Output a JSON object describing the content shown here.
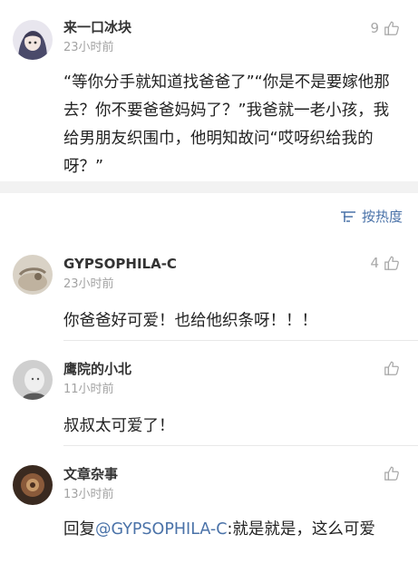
{
  "comments": [
    {
      "user": "来一口冰块",
      "time": "23小时前",
      "likes": "9",
      "text": "“等你分手就知道找爸爸了”“你是不是要嫁他那去？你不要爸爸妈妈了？”我爸就一老小孩，我给男朋友织围巾，他明知故问“哎呀织给我的呀？”"
    }
  ],
  "sort": {
    "label": "按热度",
    "icon": "sort-lines-icon"
  },
  "replies": [
    {
      "user": "GYPSOPHILA-C",
      "time": "23小时前",
      "likes": "4",
      "text": "你爸爸好可爱！也给他织条呀！！！"
    },
    {
      "user": "鹰院的小北",
      "time": "11小时前",
      "likes": "",
      "text": "叔叔太可爱了！"
    },
    {
      "user": "文章杂事",
      "time": "13小时前",
      "likes": "",
      "text_prefix": "回复",
      "mention": "@GYPSOPHILA-C",
      "text_suffix": ":就是就是，这么可爱"
    }
  ],
  "colors": {
    "accent": "#4a72a8",
    "muted": "#a3a3a3",
    "band": "#f2f2f2"
  }
}
